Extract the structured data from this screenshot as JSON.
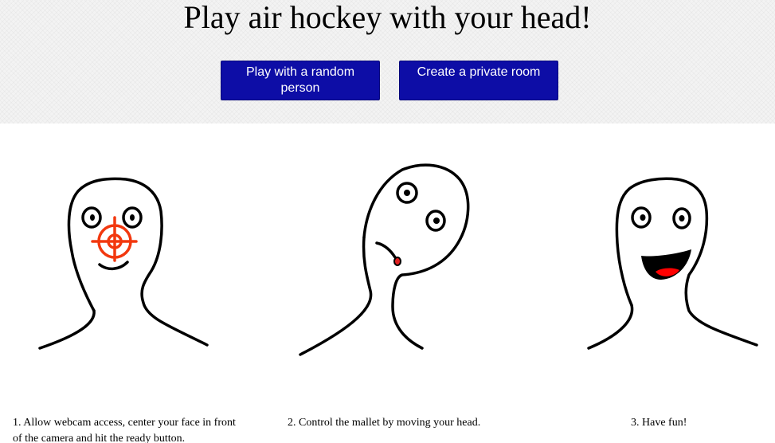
{
  "header": {
    "title": "Play air hockey with your head!"
  },
  "buttons": {
    "random_label": "Play with a random person",
    "private_label": "Create a private room"
  },
  "steps": [
    {
      "text": "1. Allow webcam access, center your face in front of the camera and hit the ready button."
    },
    {
      "text": "2. Control the mallet by moving your head."
    },
    {
      "text": "3. Have fun!"
    }
  ],
  "colors": {
    "button_bg": "#0d0da6",
    "button_text": "#ffffff",
    "hero_bg": "#f3f3f3",
    "target": "#f2380f",
    "mouth_red": "#ff0000"
  },
  "icons": [
    "face-target-drawing",
    "tilted-head-drawing",
    "happy-face-drawing"
  ]
}
